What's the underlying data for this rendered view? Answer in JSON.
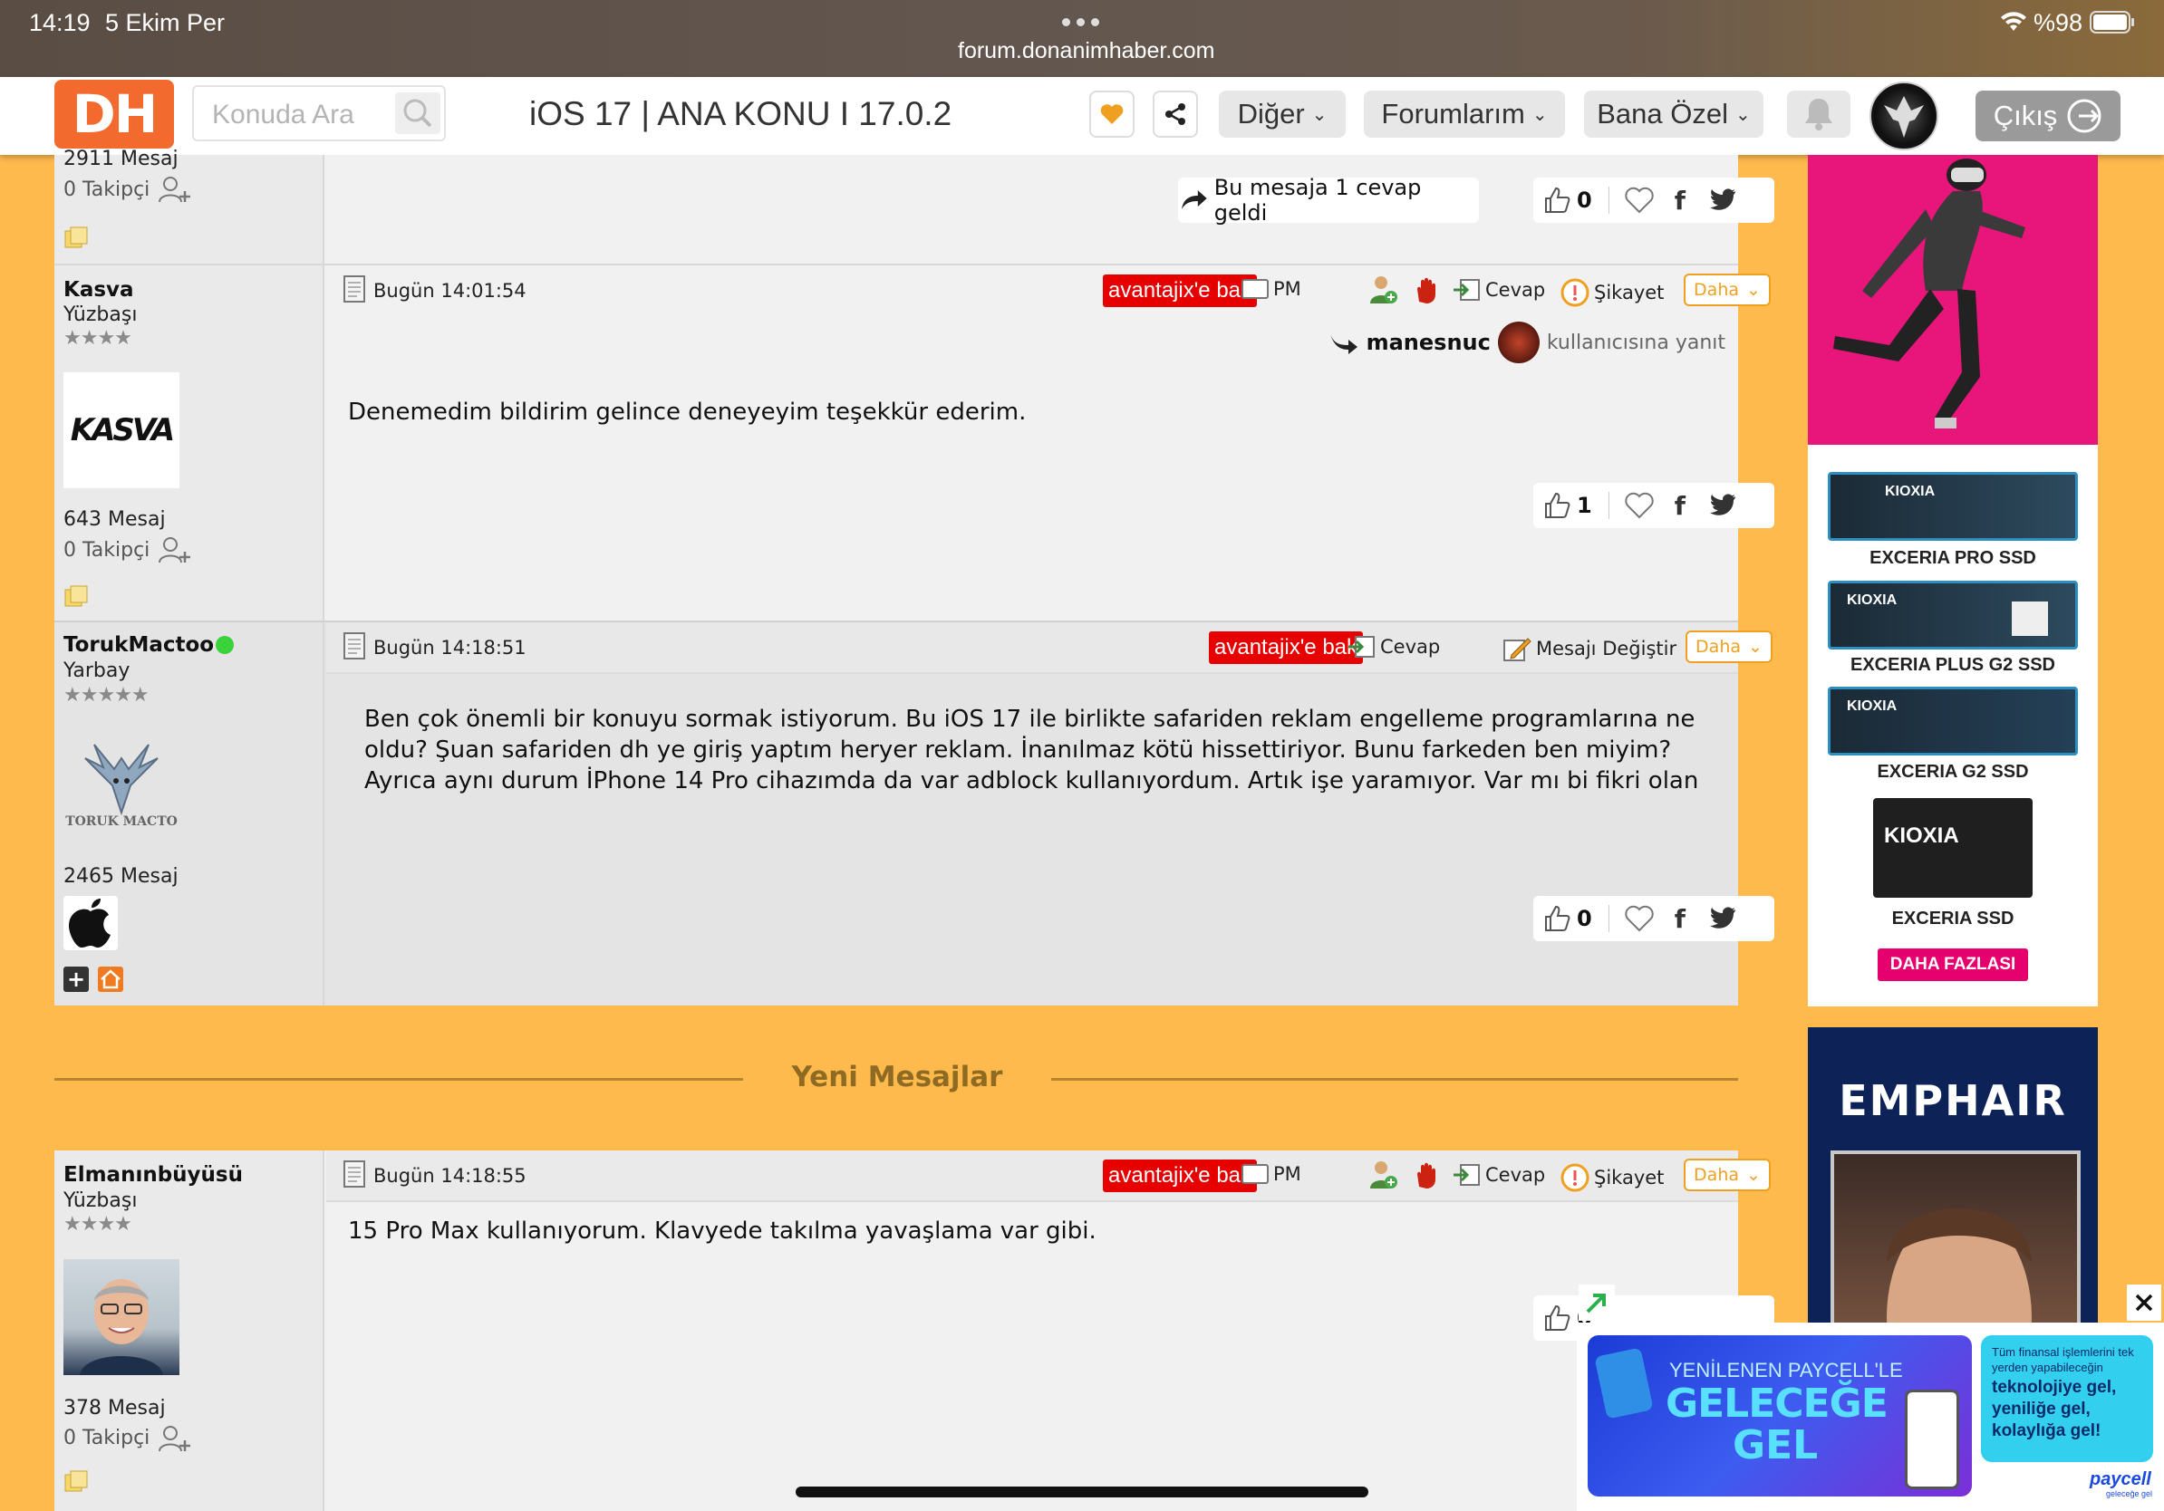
{
  "status_bar": {
    "time": "14:19",
    "date": "5 Ekim Per",
    "battery": "%98",
    "url": "forum.donanimhaber.com"
  },
  "nav": {
    "logo": "DH",
    "search_placeholder": "Konuda Ara",
    "topic_title": "iOS 17 | ANA KONU I 17.0.2",
    "diger": "Diğer",
    "forumlarim": "Forumlarım",
    "bana_ozel": "Bana Özel",
    "cikis": "Çıkış"
  },
  "prev_post": {
    "count": "2911 Mesaj",
    "followers": "0 Takipçi",
    "replies_button": "Bu mesaja 1 cevap geldi",
    "likes": "0"
  },
  "posts": [
    {
      "username": "Kasva",
      "rank": "Yüzbaşı",
      "stars": "★★★★",
      "avatar_text": "KASVA",
      "count": "643 Mesaj",
      "followers": "0 Takipçi",
      "date": "Bugün 14:01:54",
      "avantaj": "avantajix'e bak",
      "pm": "PM",
      "cevap": "Cevap",
      "sikayet": "Şikayet",
      "daha": "Daha",
      "reply_to_user": "manesnuc",
      "reply_to_suffix": "kullanıcısına yanıt",
      "body": "Denemedim bildirim gelince deneyeyim teşekkür ederim.",
      "likes": "1"
    },
    {
      "username": "TorukMactoo",
      "rank": "Yarbay",
      "stars": "★★★★★",
      "avatar_text": "TORUK MACTO",
      "count": "2465 Mesaj",
      "date": "Bugün 14:18:51",
      "avantaj": "avantajix'e bak",
      "cevap": "Cevap",
      "edit": "Mesajı Değiştir",
      "daha": "Daha",
      "body": "Ben çok önemli bir konuyu sormak istiyorum. Bu iOS 17 ile birlikte safariden reklam engelleme programlarına ne oldu? Şuan safariden dh ye giriş yaptım heryer reklam. İnanılmaz kötü hissettiriyor. Bunu farkeden ben miyim? Ayrıca aynı durum İPhone 14 Pro cihazımda da var adblock kullanıyordum. Artık işe yaramıyor. Var mı bi fikri olan",
      "likes": "0"
    },
    {
      "username": "Elmanınbüyüsü",
      "rank": "Yüzbaşı",
      "stars": "★★★★",
      "count": "378 Mesaj",
      "followers": "0 Takipçi",
      "date": "Bugün 14:18:55",
      "avantaj": "avantajix'e bak",
      "pm": "PM",
      "cevap": "Cevap",
      "sikayet": "Şikayet",
      "daha": "Daha",
      "body": "15 Pro Max kullanıyorum. Klavyede takılma yavaşlama var gibi.",
      "likes": "0"
    }
  ],
  "divider": {
    "label": "Yeni Mesajlar"
  },
  "ads": {
    "ssd": [
      {
        "label": "KIOXIA",
        "name": "EXCERIA PRO SSD"
      },
      {
        "label": "KIOXIA",
        "name": "EXCERIA PLUS G2 SSD"
      },
      {
        "label": "KIOXIA",
        "name": "EXCERIA G2 SSD"
      },
      {
        "label": "KIOXIA",
        "name": "EXCERIA SSD"
      }
    ],
    "more": "DAHA FAZLASI",
    "emphair": "EMPHAIR",
    "banner_top": "YENİLENEN PAYCELL'LE",
    "banner_big1": "GELECEĞE",
    "banner_big2": "GEL",
    "banner_side1": "Tüm finansal işlemlerini tek yerden yapabileceğin",
    "banner_side2": "teknolojiye gel, yeniliğe gel, kolaylığa gel!",
    "paycell": "paycell",
    "paycell_sub": "geleceğe gel"
  },
  "colors": {
    "page_bg": "#FFBA4E",
    "accent_red": "#E60000",
    "logo_orange": "#F26A2E",
    "daha_orange": "#F0A020"
  }
}
